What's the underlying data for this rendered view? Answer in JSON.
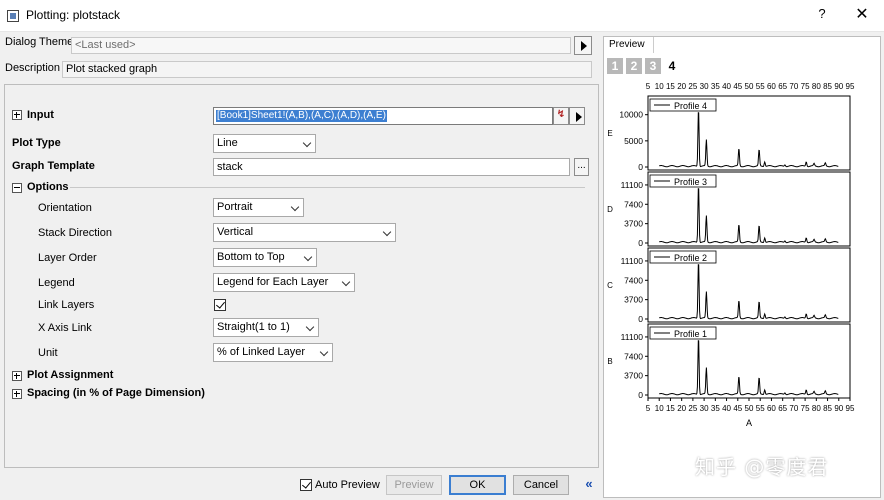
{
  "window": {
    "title": "Plotting: plotstack",
    "help": "?",
    "close": "✕"
  },
  "dialog_theme": {
    "label": "Dialog Theme",
    "value": "<Last used>"
  },
  "description": {
    "label": "Description",
    "value": "Plot stacked graph"
  },
  "input": {
    "label": "Input",
    "value": "[Book1]Sheet1!(A,B),(A,C),(A,D),(A,E)",
    "picker": "↯"
  },
  "plot_type": {
    "label": "Plot Type",
    "value": "Line"
  },
  "graph_template": {
    "label": "Graph Template",
    "value": "stack",
    "browse": "..."
  },
  "options": {
    "label": "Options",
    "orientation": {
      "label": "Orientation",
      "value": "Portrait"
    },
    "stack_direction": {
      "label": "Stack Direction",
      "value": "Vertical"
    },
    "layer_order": {
      "label": "Layer Order",
      "value": "Bottom to Top"
    },
    "legend": {
      "label": "Legend",
      "value": "Legend for Each Layer"
    },
    "link_layers": {
      "label": "Link Layers",
      "checked": true
    },
    "x_axis_link": {
      "label": "X Axis Link",
      "value": "Straight(1 to 1)"
    },
    "unit": {
      "label": "Unit",
      "value": "% of Linked Layer"
    }
  },
  "plot_assignment": {
    "label": "Plot Assignment"
  },
  "spacing": {
    "label": "Spacing (in % of Page Dimension)"
  },
  "footer": {
    "auto_preview": "Auto Preview",
    "auto_preview_checked": true,
    "preview": "Preview",
    "ok": "OK",
    "cancel": "Cancel",
    "collapse": "«"
  },
  "preview": {
    "tab": "Preview",
    "page_tabs": [
      "1",
      "2",
      "3",
      "4"
    ],
    "active_page": "4",
    "watermark": "知乎 @零度君"
  },
  "chart_data": {
    "type": "line",
    "xlabel": "A",
    "x_ticks": [
      "5",
      "10",
      "15",
      "20",
      "25",
      "30",
      "35",
      "40",
      "45",
      "50",
      "55",
      "60",
      "65",
      "70",
      "75",
      "80",
      "85",
      "90",
      "95"
    ],
    "xlim": [
      5,
      95
    ],
    "peaks": [
      {
        "x": 27.5,
        "rel": 1.0
      },
      {
        "x": 31,
        "rel": 0.45
      },
      {
        "x": 45.5,
        "rel": 0.3
      },
      {
        "x": 54.5,
        "rel": 0.28
      },
      {
        "x": 57,
        "rel": 0.08
      },
      {
        "x": 66,
        "rel": 0.03
      },
      {
        "x": 75.5,
        "rel": 0.08
      },
      {
        "x": 79,
        "rel": 0.04
      },
      {
        "x": 84,
        "rel": 0.05
      }
    ],
    "layers": [
      {
        "ylabel": "E",
        "legend": "Profile 4",
        "yticks": [
          "10000",
          "5000",
          "0"
        ],
        "yvals": [
          10000,
          5000,
          0
        ],
        "ymax": 13000
      },
      {
        "ylabel": "D",
        "legend": "Profile 3",
        "yticks": [
          "11100",
          "7400",
          "3700",
          "0"
        ],
        "yvals": [
          11100,
          7400,
          3700,
          0
        ],
        "ymax": 13000
      },
      {
        "ylabel": "C",
        "legend": "Profile 2",
        "yticks": [
          "11100",
          "7400",
          "3700",
          "0"
        ],
        "yvals": [
          11100,
          7400,
          3700,
          0
        ],
        "ymax": 13000
      },
      {
        "ylabel": "B",
        "legend": "Profile 1",
        "yticks": [
          "11100",
          "7400",
          "3700",
          "0"
        ],
        "yvals": [
          11100,
          7400,
          3700,
          0
        ],
        "ymax": 13000
      }
    ]
  }
}
